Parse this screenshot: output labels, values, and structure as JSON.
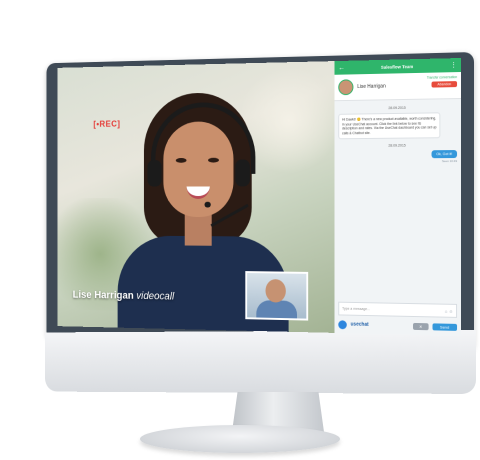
{
  "video": {
    "rec_label": "[•REC]",
    "caller_name": "Lise Harrigan",
    "call_type": "videocall"
  },
  "chat": {
    "header_title": "Salesflow Team",
    "contact_name": "Lise Harrigan",
    "transfer_label": "Transfer conversation",
    "abandon_label": "Abandon",
    "date1": "28.09.2015",
    "message_in": "Hi Dawid! 😊 There's a new product available, worth considering, in your UseChat account. Click the link below to see its description and rates. Via the UseChat dashboard you can set up calls & Chatbot site.",
    "date2": "28.09.2015",
    "message_out": "Ok, Got it!",
    "seen_label": "Seen 10:49",
    "input_placeholder": "Type a message...",
    "brand": "usechat",
    "send_label": "Send"
  },
  "colors": {
    "accent_green": "#2fb56b",
    "accent_blue": "#3498db",
    "abandon_red": "#e74c3c",
    "bezel": "#3f4a56"
  }
}
